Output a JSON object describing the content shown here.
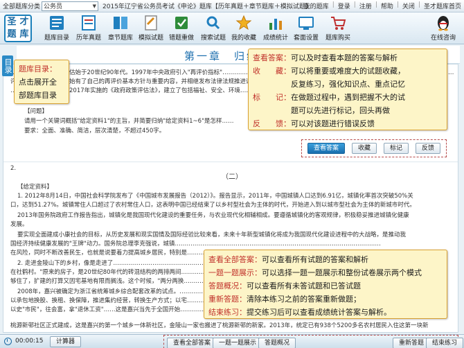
{
  "topbar": {
    "exam_label": "全部题库分类",
    "exam_select": "公务员",
    "title": "2015年辽宁省公务员考试《申论》题库【历年真题＋章节题库＋模拟试题】",
    "links": [
      "我的题库",
      "登录",
      "注册",
      "帮助",
      "关闭",
      "圣才题库首页"
    ]
  },
  "logo": {
    "chars": [
      "圣",
      "才",
      "题",
      "库"
    ]
  },
  "toolbar": {
    "items": [
      {
        "label": "题库目录",
        "icon": "catalog-icon",
        "color": "#1f7fbf"
      },
      {
        "label": "历年真题",
        "icon": "past-exams-icon",
        "color": "#1f7fbf"
      },
      {
        "label": "章节题库",
        "icon": "chapter-icon",
        "color": "#1f7fbf"
      },
      {
        "label": "模拟试题",
        "icon": "mock-exam-icon",
        "color": "#1f7fbf"
      },
      {
        "label": "错题重做",
        "icon": "redo-wrong-icon",
        "color": "#2e8c3a"
      },
      {
        "label": "搜索试题",
        "icon": "search-icon",
        "color": "#1f7fbf"
      },
      {
        "label": "我的收藏",
        "icon": "favorites-icon",
        "color": "#d88a1a"
      },
      {
        "label": "成绩统计",
        "icon": "stats-icon",
        "color": "#2e8c3a"
      },
      {
        "label": "套面设置",
        "icon": "settings-icon",
        "color": "#1f7fbf"
      },
      {
        "label": "题库购买",
        "icon": "cart-icon",
        "color": "#c03030"
      }
    ],
    "online": {
      "label": "在线咨询",
      "icon": "qq-penguin-icon"
    }
  },
  "chapter": {
    "title": "第一章　归纳概"
  },
  "sidetab": {
    "label": "目录"
  },
  "content": {
    "line1": "……………政府绩效评估始于20世纪90年代。1997年中央政府引入\"再评价指标\"……………………………………………………………………………………………………………事业",
    "line2": "评价工作……………开始有了自己的再评价基本方针与重要内容，并相继发布法律法规推进评估制度化……………………………………………………………………，为",
    "line3": "…………………………2017年实施的《政府政策评估法》，建立了包括福祉、安全、环境……………………………………………………………………………",
    "line4": "（、）事评价机制。",
    "q_head": "【问题】",
    "q_line1": "请用一个关键词概括\"给定资料1\"的主旨，并简要归纳\"给定资料1~6\"是怎样……",
    "q_line2": "要求：全面、准确、简洁，层次清楚，不超过450字。",
    "q_num": "2.",
    "section": "（二）",
    "mat_head": "【给定资料】",
    "p1a": "1. 2012年8月14日，中国社会科学院发布了《中国城市发展报告（2012）》。报告显示，2011年，中国城镇人口达到6.91亿，城镇化率首次突破50%关",
    "p1b": "口，达到51.27%。城镇常住人口超过了农村常住人口，这表明中国已经结束了以乡村型社会为主体的时代，开始进入到以城市型社会为主体的新城市时代。",
    "p2a": "2013年国务院政府工作报告指出，城镇化是我国现代化建设的重要任务，与农业现代化相辅相成。要遵循城镇化的客观规律，积极稳妥推进城镇化健康",
    "p2b": "发展。",
    "p3a": "要实现全面建成小康社会的目标，从历史发展和现实国情及国际经验比较来看，未来十年新型城镇化将成为我国现代化建设进程中的大战略，是推动我",
    "p3b": "国经济持续健康发展的\"王牌\"动力。国务院总理李克强说，城镇……………………………………………………………………………………………",
    "p3c": "在风险，同时不断改善民生，也就是说要着力提高城乡居民，特别是……………………………………………………………………………………………",
    "p4a": "2. 走进金陵山下的乡村，像是走进了……………………………………………………………………………………………………………………………………",
    "p4b": "在社鹤村。\"原来的房子，是20世纪80年代的砖混结构的两排两间……………………………………………………………………………………………………",
    "p4c": "够住了，扩建的打算又因宅基地有限而搁浅。这个时候，\"两分两换…………………………………………………………………………………………………",
    "p4d": "2008年，嘉兴被确定为浙江省统筹城乡综合配套改革的试点。………………………………………………………………………………………………………",
    "p4e": "以承包地换股、换租、换保障，推进集约经营，转换生产方式；以宅……………………………………………………………………………………………………",
    "p4f": "以史\"市民\"，往会富，拿\"退休工资\"……这是嘉兴当先于全国开始……………………………………………………………………………………………………",
    "p4g": "桃源新邨社区正式建成，这是嘉兴的第一个城乡一体新社区，金陵山一家也搬进了桃源新邨的新家。2013年，统定已有938个5200多名农村居民入住这第一块新"
  },
  "answer_buttons": {
    "show_answer": "查看答案",
    "favorite": "收藏",
    "mark": "标记",
    "feedback": "反馈"
  },
  "callout_top": {
    "rows": [
      {
        "k": "查看答案：",
        "v": "可以及时查看本题的答案与解析"
      },
      {
        "k": "收　　藏：",
        "v": "可以将重要或难度大的试题收藏，"
      },
      {
        "k": "",
        "v": "反复练习，强化知识点、重点记忆"
      },
      {
        "k": "标　　记：",
        "v": "在做题过程中，遇到把握不大的试"
      },
      {
        "k": "",
        "v": "题可以先进行标记，回头再做"
      },
      {
        "k": "反　　馈：",
        "v": "可以对该题进行错误反馈"
      }
    ]
  },
  "callout_catalog": {
    "rows": [
      {
        "k": "题库目录：",
        "v": ""
      },
      {
        "k": "",
        "v": "点击展开全"
      },
      {
        "k": "",
        "v": "部题库目录"
      }
    ]
  },
  "callout_bottom": {
    "rows": [
      {
        "k": "查看全部答案：",
        "v": "可以查看所有试题的答案和解析"
      },
      {
        "k": "一题一题展示：",
        "v": "可以选择一题一题展示和整份试卷展示两个模式"
      },
      {
        "k": "答题概况：",
        "v": "可以查看所有未答试题和已答试题"
      },
      {
        "k": "重新答题：",
        "v": "清除本练习之前的答案重新做题；"
      },
      {
        "k": "结束练习：",
        "v": "提交练习后可以查看成绩统计答案与解析。"
      }
    ]
  },
  "statusbar": {
    "time": "00:00:15",
    "calculator": "计算器",
    "view_all": "查看全部答案",
    "one_by_one": "一题一题展示",
    "overview": "答题概况",
    "restart": "重新答题",
    "finish": "结束练习"
  }
}
